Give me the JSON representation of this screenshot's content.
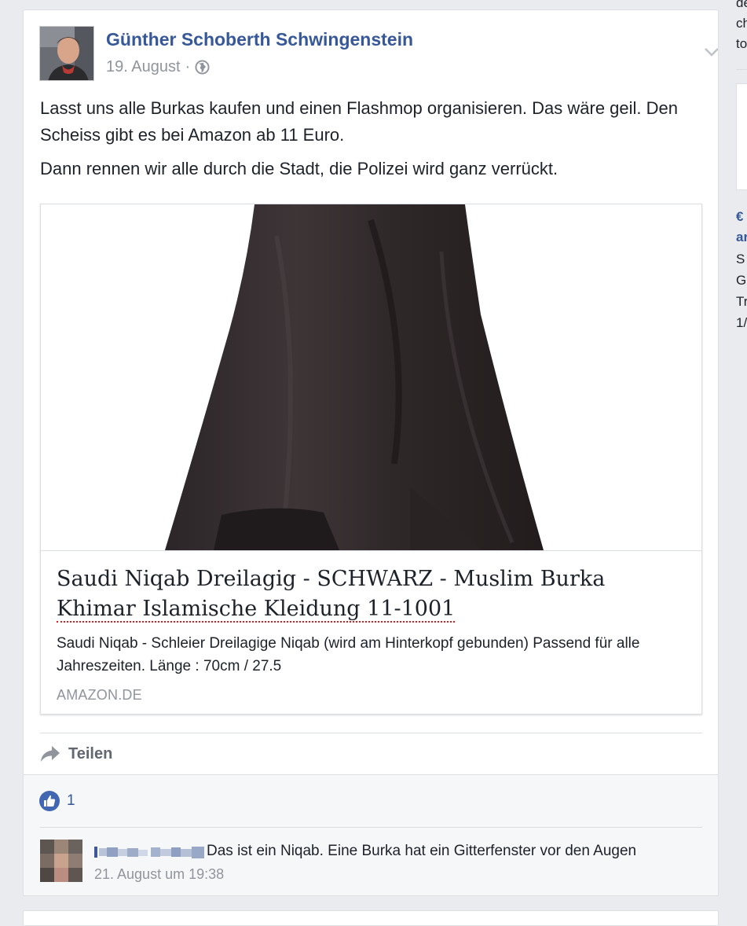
{
  "post": {
    "author": "Günther Schoberth Schwingenstein",
    "date": "19. August",
    "separator": "·",
    "paragraphs": [
      "Lasst uns alle Burkas kaufen und einen Flashmop organisieren. Das wäre geil. Den Scheiss gibt es bei Amazon ab 11 Euro.",
      "Dann rennen wir alle durch die Stadt, die Polizei wird ganz verrückt."
    ],
    "icons": {
      "audience": "globe-icon",
      "menu": "chevron-down-icon"
    }
  },
  "link_preview": {
    "title_main": "Saudi Niqab Dreilagig - SCHWARZ - Muslim Burka ",
    "title_flagged": "Khimar Islamische Kleidung 11-1001",
    "description": "Saudi Niqab - Schleier Dreilagige Niqab (wird am Hinterkopf gebunden) Passend für alle Jahreszeiten. Länge : 70cm / 27.5",
    "domain": "AMAZON.DE"
  },
  "actions": {
    "share_label": "Teilen"
  },
  "reactions": {
    "like_count": "1"
  },
  "comment": {
    "text": "Das ist ein Niqab. Eine Burka hat ein Gitterfenster vor den Augen",
    "time": "21. August um 19:38"
  },
  "right_column": {
    "fragments": [
      "de",
      "ch",
      "to",
      "€",
      "ar",
      "S",
      "G",
      "Tr",
      "1/"
    ]
  },
  "colors": {
    "link_blue": "#365899",
    "meta_gray": "#90949c",
    "background": "#e9ebee",
    "like_blue": "#4267b2",
    "spellcheck_red": "#e0191a"
  }
}
